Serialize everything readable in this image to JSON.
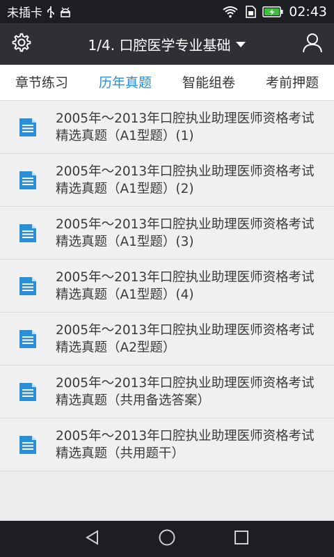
{
  "status_bar": {
    "carrier": "未插卡",
    "time": "02:43",
    "icons": [
      "usb-icon",
      "android-debug-icon",
      "wifi-icon",
      "sim-icon",
      "battery-charging-icon"
    ]
  },
  "header": {
    "title": "1/4. 口腔医学专业基础",
    "left_icon": "gear-icon",
    "right_icon": "user-icon"
  },
  "tabs": [
    {
      "label": "章节练习",
      "active": false
    },
    {
      "label": "历年真题",
      "active": true
    },
    {
      "label": "智能组卷",
      "active": false
    },
    {
      "label": "考前押题",
      "active": false
    }
  ],
  "items": [
    {
      "title": "2005年～2013年口腔执业助理医师资格考试精选真题（A1型题）(1)"
    },
    {
      "title": "2005年～2013年口腔执业助理医师资格考试精选真题（A1型题）(2)"
    },
    {
      "title": "2005年～2013年口腔执业助理医师资格考试精选真题（A1型题）(3)"
    },
    {
      "title": "2005年～2013年口腔执业助理医师资格考试精选真题（A1型题）(4)"
    },
    {
      "title": "2005年～2013年口腔执业助理医师资格考试精选真题（A2型题）"
    },
    {
      "title": "2005年～2013年口腔执业助理医师资格考试精选真题（共用备选答案）"
    },
    {
      "title": "2005年～2013年口腔执业助理医师资格考试精选真题（共用题干）"
    }
  ],
  "colors": {
    "accent": "#2b8fd6",
    "header_bg": "#2e3033",
    "status_bg": "#1c1e21",
    "battery": "#3fbf3f"
  }
}
